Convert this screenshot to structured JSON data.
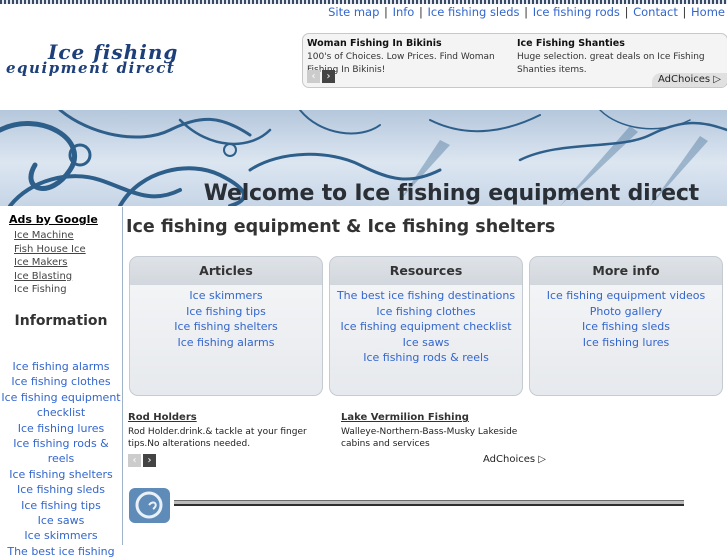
{
  "topnav": {
    "items": [
      "Site map",
      "Info",
      "Ice fishing sleds",
      "Ice fishing rods",
      "Contact",
      "Home"
    ],
    "separator": "|"
  },
  "logo": {
    "line1": "Ice fishing",
    "line2": "equipment direct"
  },
  "top_ad": {
    "ads": [
      {
        "title": "Woman Fishing In Bikinis",
        "text": "100's of Choices. Low Prices. Find Woman Fishing In Bikinis!"
      },
      {
        "title": "Ice Fishing Shanties",
        "text": "Huge selection. great deals on Ice Fishing Shanties items."
      }
    ],
    "prev_glyph": "‹",
    "next_glyph": "›",
    "adchoices": "AdChoices"
  },
  "banner": {
    "title": "Welcome to Ice fishing equipment direct"
  },
  "sidebar": {
    "ads_by_google": "Ads by Google",
    "ad_links": [
      "Ice Machine",
      "Fish House Ice",
      "Ice Makers",
      "Ice Blasting",
      "Ice Fishing"
    ],
    "info_heading": "Information",
    "info_links": [
      "Ice fishing alarms",
      "Ice fishing clothes",
      "Ice fishing equipment checklist",
      "Ice fishing lures",
      "Ice fishing rods & reels",
      "Ice fishing shelters",
      "Ice fishing sleds",
      "Ice fishing tips",
      "Ice saws",
      "Ice skimmers",
      "The best ice fishing"
    ]
  },
  "main": {
    "title": "Ice fishing equipment & Ice fishing shelters",
    "boxes": [
      {
        "heading": "Articles",
        "links": [
          "Ice skimmers",
          "Ice fishing tips",
          "Ice fishing shelters",
          "Ice fishing alarms"
        ]
      },
      {
        "heading": "Resources",
        "links": [
          "The best ice fishing destinations",
          "Ice fishing clothes",
          "Ice fishing equipment checklist",
          "Ice saws",
          "Ice fishing rods & reels"
        ]
      },
      {
        "heading": "More info",
        "links": [
          "Ice fishing equipment videos",
          "Photo gallery",
          "Ice fishing sleds",
          "Ice fishing lures"
        ]
      }
    ]
  },
  "bottom_ad": {
    "ads": [
      {
        "title": "Rod Holders",
        "text": "Rod Holder.drink.& tackle at your finger tips.No alterations needed."
      },
      {
        "title": "Lake Vermilion Fishing",
        "text": "Walleye-Northern-Bass-Musky Lakeside cabins and services"
      }
    ],
    "adchoices": "AdChoices"
  },
  "colors": {
    "link": "#3366cc",
    "logo": "#1d3f7a",
    "banner_swirl": "#2d5f8a"
  }
}
